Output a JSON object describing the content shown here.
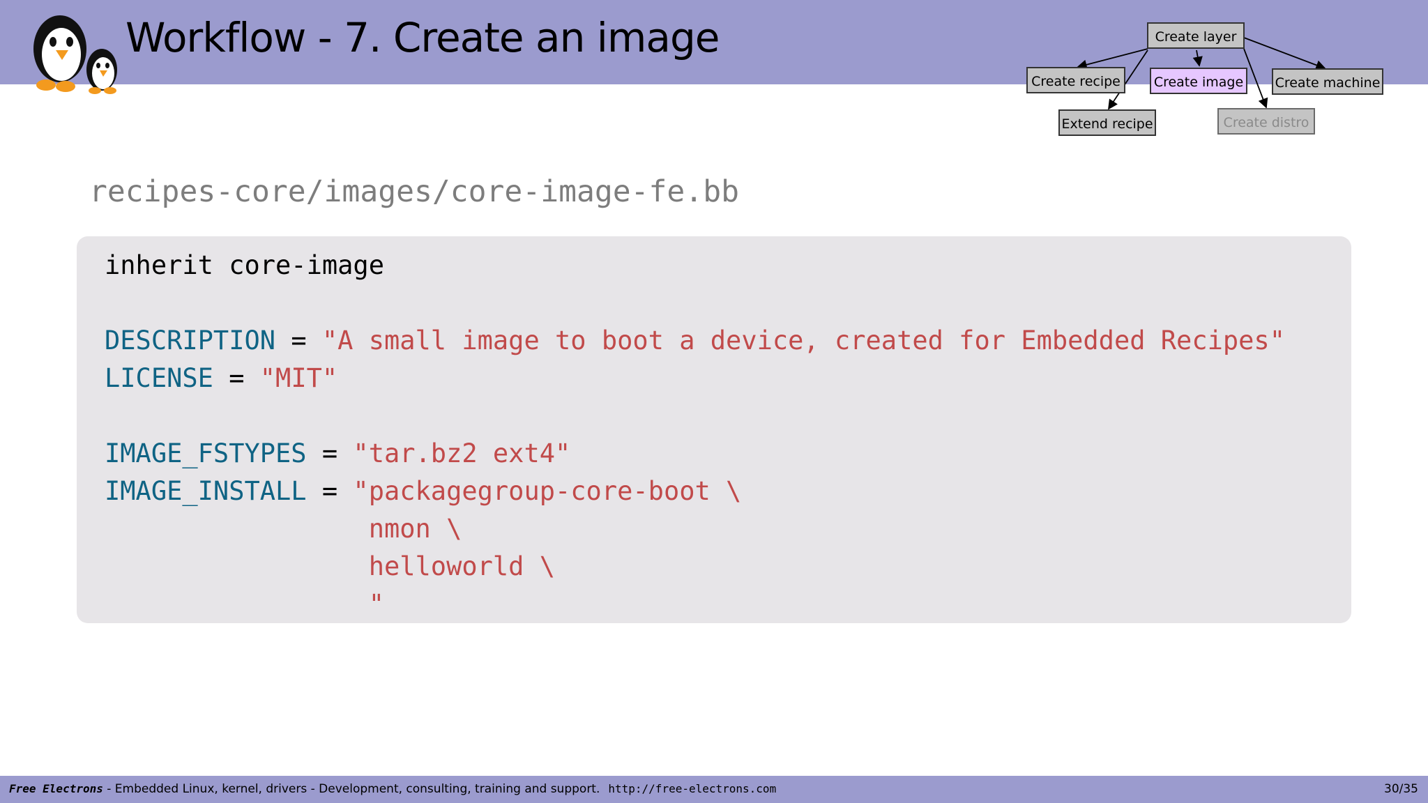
{
  "header": {
    "title": "Workflow - 7. Create an image",
    "flow": {
      "create_layer": "Create layer",
      "create_recipe": "Create recipe",
      "create_image": "Create image",
      "create_machine": "Create machine",
      "extend_recipe": "Extend recipe",
      "create_distro": "Create distro"
    }
  },
  "content": {
    "filename": "recipes-core/images/core-image-fe.bb",
    "code": {
      "line1": "inherit core-image",
      "desc_key": "DESCRIPTION",
      "desc_val": "\"A small image to boot a device, created for Embedded Recipes\"",
      "license_key": "LICENSE",
      "license_val": "\"MIT\"",
      "fstypes_key": "IMAGE_FSTYPES",
      "fstypes_val": "\"tar.bz2 ext4\"",
      "install_key": "IMAGE_INSTALL",
      "install_val1": "\"packagegroup-core-boot \\",
      "install_val2": "nmon \\",
      "install_val3": "helloworld \\",
      "install_val4": "\"",
      "eq": " = "
    }
  },
  "footer": {
    "brand": "Free Electrons",
    "tagline": " - Embedded Linux, kernel, drivers - Development, consulting, training and support.",
    "url": "http://free-electrons.com",
    "page": "30/35"
  },
  "colors": {
    "header_bg": "#9b9bce",
    "keyword": "#0f6384",
    "string": "#c14a4a",
    "active_node": "#e6c7ff"
  }
}
